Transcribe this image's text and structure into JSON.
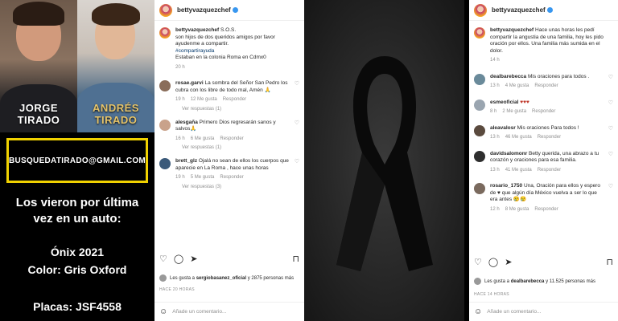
{
  "poster": {
    "person1": "JORGE TIRADO",
    "person2": "ANDRÉS TIRADO",
    "email": "BUSQUEDATIRADO@GMAIL.COM",
    "line1": "Los vieron por última",
    "line2": "vez en un auto:",
    "car": "Ónix 2021",
    "color": "Color: Gris Oxford",
    "plates": "Placas: JSF4558"
  },
  "post1": {
    "username": "bettyvazquezchef",
    "caption_user": "bettyvazquezchef",
    "caption_sos": "S.O.S.",
    "caption_text": "son hijos de dos queridos amigos por favor ayudenme a compartir.",
    "hashtag": "#compartirayuda",
    "caption_location": "Estaban en la colonia Roma en Cdmx0",
    "caption_time": "20 h",
    "comments": [
      {
        "user": "rosae.garvi",
        "text": "La sombra del Señor San Pedro los cubra con los libre de todo mal, Amén 🙏",
        "time": "19 h",
        "likes": "12 Me gusta",
        "reply": "Responder",
        "replies": "Ver respuestas (1)"
      },
      {
        "user": "alesgaña",
        "text": "Primero Dios regresarán sanos y salvos🙏",
        "time": "16 h",
        "likes": "6 Me gusta",
        "reply": "Responder",
        "replies": "Ver respuestas (1)"
      },
      {
        "user": "brett_glz",
        "text": "Ojalá no sean de ellos los cuerpos que aparecie en La Roma , hace unas horas",
        "time": "19 h",
        "likes": "5 Me gusta",
        "reply": "Responder",
        "replies": "Ver respuestas (3)"
      }
    ],
    "likes_text": "Les gusta a",
    "likes_user": "sergiobasanez_oficial",
    "likes_rest": "y 2875 personas más",
    "ago": "HACE 20 HORAS",
    "comment_placeholder": "Añade un comentario..."
  },
  "post2": {
    "username": "bettyvazquezchef",
    "caption_user": "bettyvazquezchef",
    "caption_text": "Hace unas horas les pedí compartir la angustia de una familia, hoy les pido oración por ellos. Una familia más sumida en el dolor.",
    "caption_time": "14 h",
    "comments": [
      {
        "user": "dealbarebecca",
        "text": "Mis oraciones para todos .",
        "time": "13 h",
        "likes": "4 Me gusta",
        "reply": "Responder"
      },
      {
        "user": "esmeoficial",
        "text": "♥♥♥",
        "time": "8 h",
        "likes": "2 Me gusta",
        "reply": "Responder"
      },
      {
        "user": "aleavalosr",
        "text": "Mis oraciones Para todos !",
        "time": "13 h",
        "likes": "46 Me gusta",
        "reply": "Responder"
      },
      {
        "user": "davidsalomonr",
        "text": "Betty querida, una abrazo a tu corazón y oraciones para esa familia.",
        "time": "13 h",
        "likes": "41 Me gusta",
        "reply": "Responder"
      },
      {
        "user": "rosario_1750",
        "text": "Una, Oración para ellos y espero de ♥ que algún día México vuelva a ser lo que era antes 😢😢",
        "time": "12 h",
        "likes": "8 Me gusta",
        "reply": "Responder"
      }
    ],
    "likes_text": "Les gusta a",
    "likes_user": "dealbarebecca",
    "likes_rest": "y 11.525 personas más",
    "ago": "HACE 14 HORAS",
    "comment_placeholder": "Añade un comentario..."
  },
  "colors": {
    "email_border": "#f0d100",
    "andres_name": "#e6c46a",
    "verified": "#3897f0",
    "hashtag": "#00376b",
    "ribbon": "#0a0a0a"
  },
  "icons": [
    "heart-icon",
    "comment-icon",
    "share-icon",
    "bookmark-icon",
    "emoji-icon",
    "ribbon-icon"
  ]
}
